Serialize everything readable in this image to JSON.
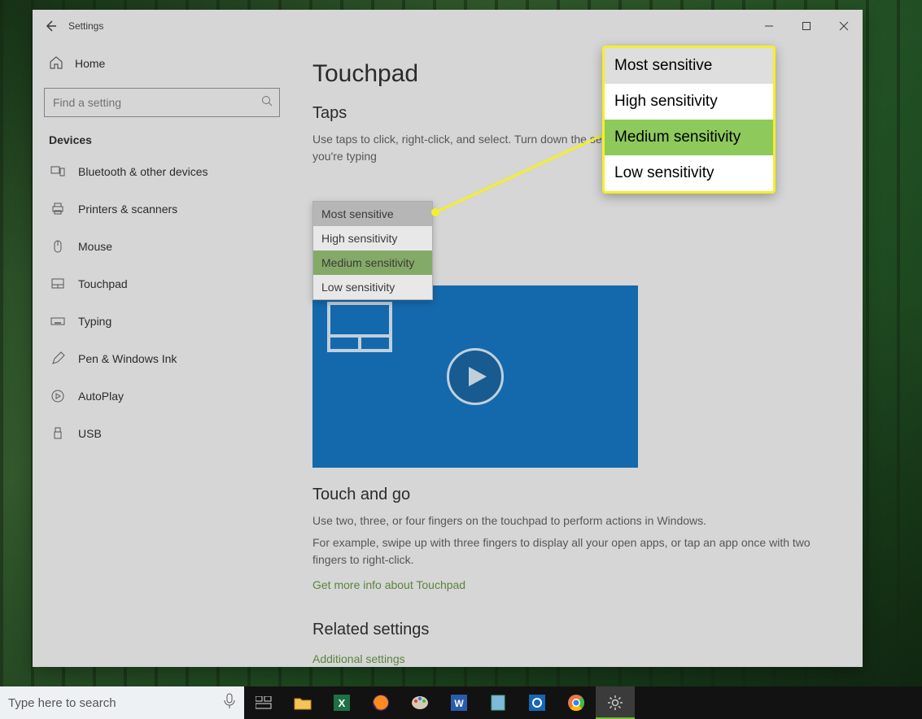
{
  "window": {
    "title": "Settings"
  },
  "sidebar": {
    "home": "Home",
    "search_placeholder": "Find a setting",
    "category": "Devices",
    "items": [
      {
        "label": "Bluetooth & other devices"
      },
      {
        "label": "Printers & scanners"
      },
      {
        "label": "Mouse"
      },
      {
        "label": "Touchpad"
      },
      {
        "label": "Typing"
      },
      {
        "label": "Pen & Windows Ink"
      },
      {
        "label": "AutoPlay"
      },
      {
        "label": "USB"
      }
    ]
  },
  "page": {
    "title": "Touchpad",
    "taps_heading": "Taps",
    "taps_desc": "Use taps to click, right-click, and select. Turn down the sensitivity if they activate while you're typing",
    "dropdown": {
      "options": [
        "Most sensitive",
        "High sensitivity",
        "Medium sensitivity",
        "Low sensitivity"
      ],
      "hovered": "Most sensitive",
      "selected": "Medium sensitivity"
    },
    "touch_heading": "Touch and go",
    "touch_line1": "Use two, three, or four fingers on the touchpad to perform actions in Windows.",
    "touch_line2": "For example, swipe up with three fingers to display all your open apps, or tap an app once with two fingers to right-click.",
    "touch_link": "Get more info about Touchpad",
    "related_heading": "Related settings",
    "related_link": "Additional settings"
  },
  "taskbar": {
    "search_placeholder": "Type here to search"
  },
  "callout": {
    "options": [
      "Most sensitive",
      "High sensitivity",
      "Medium sensitivity",
      "Low sensitivity"
    ]
  }
}
